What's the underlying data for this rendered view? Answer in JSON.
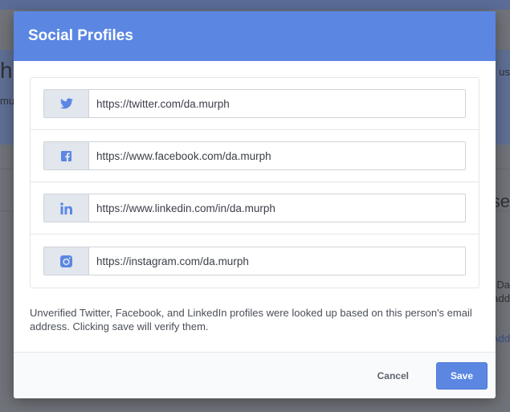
{
  "background": {
    "fragments": [
      "hi",
      "mu",
      "us",
      "se",
      "Da\nadd",
      "Add"
    ]
  },
  "modal": {
    "title": "Social Profiles",
    "profiles": [
      {
        "network": "twitter",
        "icon": "twitter-icon",
        "value": "https://twitter.com/da.murph"
      },
      {
        "network": "facebook",
        "icon": "facebook-icon",
        "value": "https://www.facebook.com/da.murph"
      },
      {
        "network": "linkedin",
        "icon": "linkedin-icon",
        "value": "https://www.linkedin.com/in/da.murph"
      },
      {
        "network": "instagram",
        "icon": "instagram-icon",
        "value": "https://instagram.com/da.murph"
      }
    ],
    "note": "Unverified Twitter, Facebook, and LinkedIn profiles were looked up based on this person's email address. Clicking save will verify them.",
    "cancel_label": "Cancel",
    "save_label": "Save"
  },
  "colors": {
    "accent": "#5b87e3",
    "icon_blue": "#5b87e3",
    "overlay": "#707379"
  }
}
